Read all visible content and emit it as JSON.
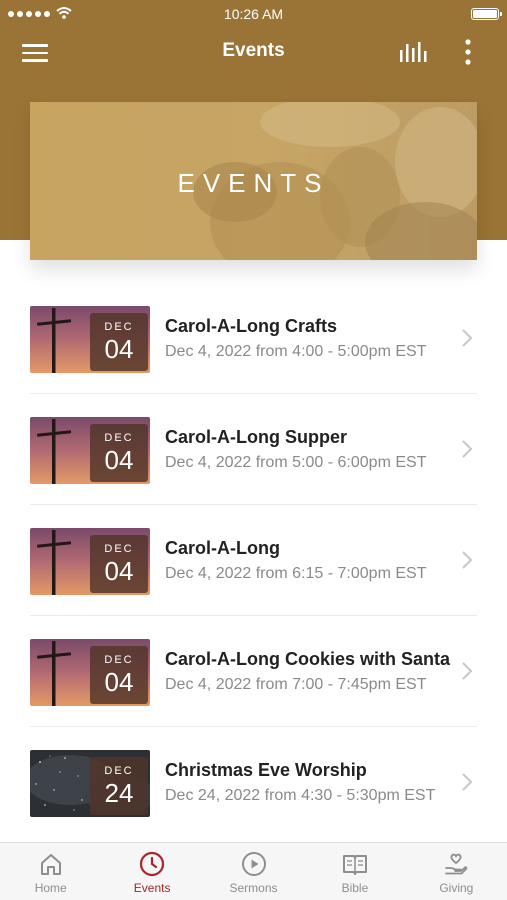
{
  "status_bar": {
    "time": "10:26 AM"
  },
  "nav": {
    "title": "Events"
  },
  "banner": {
    "title": "EVENTS"
  },
  "events": [
    {
      "month": "DEC",
      "day": "04",
      "title": "Carol-A-Long Crafts",
      "subtitle": "Dec 4, 2022 from 4:00 - 5:00pm EST",
      "thumbnail": "cross-sunset"
    },
    {
      "month": "DEC",
      "day": "04",
      "title": "Carol-A-Long Supper",
      "subtitle": "Dec 4, 2022 from 5:00 - 6:00pm EST",
      "thumbnail": "cross-sunset"
    },
    {
      "month": "DEC",
      "day": "04",
      "title": "Carol-A-Long",
      "subtitle": "Dec 4, 2022 from 6:15 - 7:00pm EST",
      "thumbnail": "cross-sunset"
    },
    {
      "month": "DEC",
      "day": "04",
      "title": "Carol-A-Long Cookies with Santa",
      "subtitle": "Dec 4, 2022 from 7:00 - 7:45pm EST",
      "thumbnail": "cross-sunset"
    },
    {
      "month": "DEC",
      "day": "24",
      "title": "Christmas Eve Worship",
      "subtitle": "Dec 24, 2022 from 4:30 - 5:30pm EST",
      "thumbnail": "starry-night"
    }
  ],
  "tabs": [
    {
      "label": "Home",
      "icon": "home-icon",
      "active": false
    },
    {
      "label": "Events",
      "icon": "clock-icon",
      "active": true
    },
    {
      "label": "Sermons",
      "icon": "play-circle-icon",
      "active": false
    },
    {
      "label": "Bible",
      "icon": "book-icon",
      "active": false
    },
    {
      "label": "Giving",
      "icon": "hand-heart-icon",
      "active": false
    }
  ],
  "colors": {
    "header": "#9a7436",
    "active_tab": "#a8242c",
    "inactive_tab": "#8e8e8e"
  }
}
